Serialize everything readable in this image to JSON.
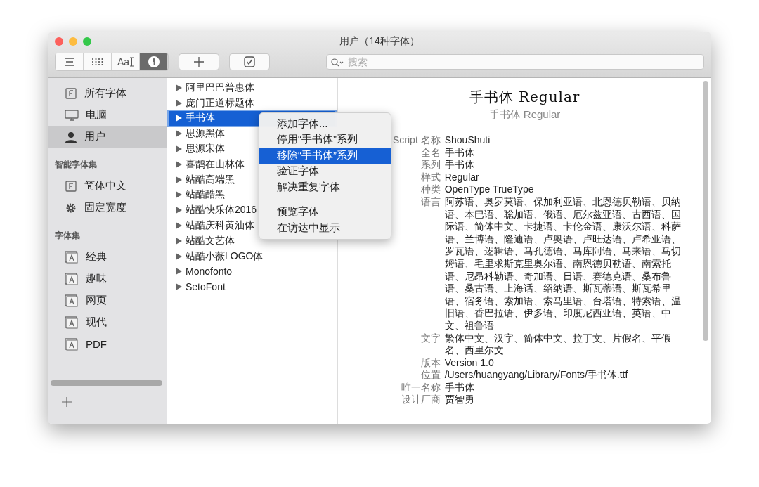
{
  "window": {
    "title": "用户（14种字体）"
  },
  "toolbar": {
    "view_buttons": [
      {
        "kind": "list",
        "selected": false
      },
      {
        "kind": "grid",
        "selected": false
      },
      {
        "kind": "sample",
        "label": "Aa",
        "selected": false
      },
      {
        "kind": "info",
        "selected": true
      }
    ],
    "search": {
      "placeholder": "搜索"
    }
  },
  "sidebar": {
    "groups": [
      {
        "items": [
          {
            "kind": "font",
            "label": "所有字体",
            "selected": false
          },
          {
            "kind": "computer",
            "label": "电脑",
            "selected": false
          },
          {
            "kind": "user",
            "label": "用户",
            "selected": true
          }
        ]
      },
      {
        "heading": "智能字体集",
        "items": [
          {
            "kind": "font",
            "label": "简体中文",
            "selected": false
          },
          {
            "kind": "gear",
            "label": "固定宽度",
            "selected": false
          }
        ]
      },
      {
        "heading": "字体集",
        "items": [
          {
            "kind": "collection",
            "label": "经典",
            "selected": false
          },
          {
            "kind": "collection",
            "label": "趣味",
            "selected": false
          },
          {
            "kind": "collection",
            "label": "网页",
            "selected": false
          },
          {
            "kind": "collection",
            "label": "现代",
            "selected": false
          },
          {
            "kind": "collection",
            "label": "PDF",
            "selected": false
          }
        ]
      }
    ]
  },
  "font_list": [
    {
      "label": "阿里巴巴普惠体",
      "selected": false
    },
    {
      "label": "庞门正道标题体",
      "selected": false
    },
    {
      "label": "手书体",
      "selected": true
    },
    {
      "label": "思源黑体",
      "selected": false
    },
    {
      "label": "思源宋体",
      "selected": false
    },
    {
      "label": "喜鹊在山林体",
      "selected": false
    },
    {
      "label": "站酷高端黑",
      "selected": false
    },
    {
      "label": "站酷酷黑",
      "selected": false
    },
    {
      "label": "站酷快乐体2016",
      "selected": false
    },
    {
      "label": "站酷庆科黄油体",
      "selected": false
    },
    {
      "label": "站酷文艺体",
      "selected": false
    },
    {
      "label": "站酷小薇LOGO体",
      "selected": false
    },
    {
      "label": "Monofonto",
      "selected": false
    },
    {
      "label": "SetoFont",
      "selected": false
    }
  ],
  "context_menu": [
    {
      "kind": "item",
      "label": "添加字体...",
      "highlighted": false
    },
    {
      "kind": "item",
      "label": "停用“手书体”系列",
      "highlighted": false
    },
    {
      "kind": "item",
      "label": "移除“手书体”系列",
      "highlighted": true
    },
    {
      "kind": "item",
      "label": "验证字体",
      "highlighted": false
    },
    {
      "kind": "item",
      "label": "解决重复字体",
      "highlighted": false
    },
    {
      "kind": "separator"
    },
    {
      "kind": "item",
      "label": "预览字体",
      "highlighted": false
    },
    {
      "kind": "item",
      "label": "在访达中显示",
      "highlighted": false
    }
  ],
  "info": {
    "preview_title": "手书体 Regular",
    "preview_subtitle": "手书体 Regular",
    "rows": [
      {
        "label": "Script 名称",
        "value": "ShouShuti"
      },
      {
        "label": "全名",
        "value": "手书体"
      },
      {
        "label": "系列",
        "value": "手书体"
      },
      {
        "label": "样式",
        "value": "Regular"
      },
      {
        "label": "种类",
        "value": "OpenType TrueType"
      },
      {
        "label": "语言",
        "value": "阿苏语、奥罗莫语、保加利亚语、北恩德贝勒语、贝纳语、本巴语、聡加语、俄语、厄尔兹亚语、古西语、国际语、简体中文、卡捷语、卡伦金语、康沃尔语、科萨语、兰博语、隆迪语、卢奥语、卢旺达语、卢希亚语、罗瓦语、逻辑语、马孔德语、马库阿语、马来语、马切姆语、毛里求斯克里奥尔语、南恩德贝勒语、南索托语、尼昂科勒语、奇加语、日语、赛德克语、桑布鲁语、桑古语、上海话、绍纳语、斯瓦蒂语、斯瓦希里语、宿务语、索加语、索马里语、台塔语、特索语、温旧语、香巴拉语、伊多语、印度尼西亚语、英语、中文、祖鲁语"
      },
      {
        "label": "文字",
        "value": "繁体中文、汉字、简体中文、拉丁文、片假名、平假名、西里尔文"
      },
      {
        "label": "版本",
        "value": "Version 1.0"
      },
      {
        "label": "位置",
        "value": "/Users/huangyang/Library/Fonts/手书体.ttf"
      },
      {
        "label": "唯一名称",
        "value": "手书体"
      },
      {
        "label": "设计厂商",
        "value": "贾智勇"
      }
    ]
  }
}
